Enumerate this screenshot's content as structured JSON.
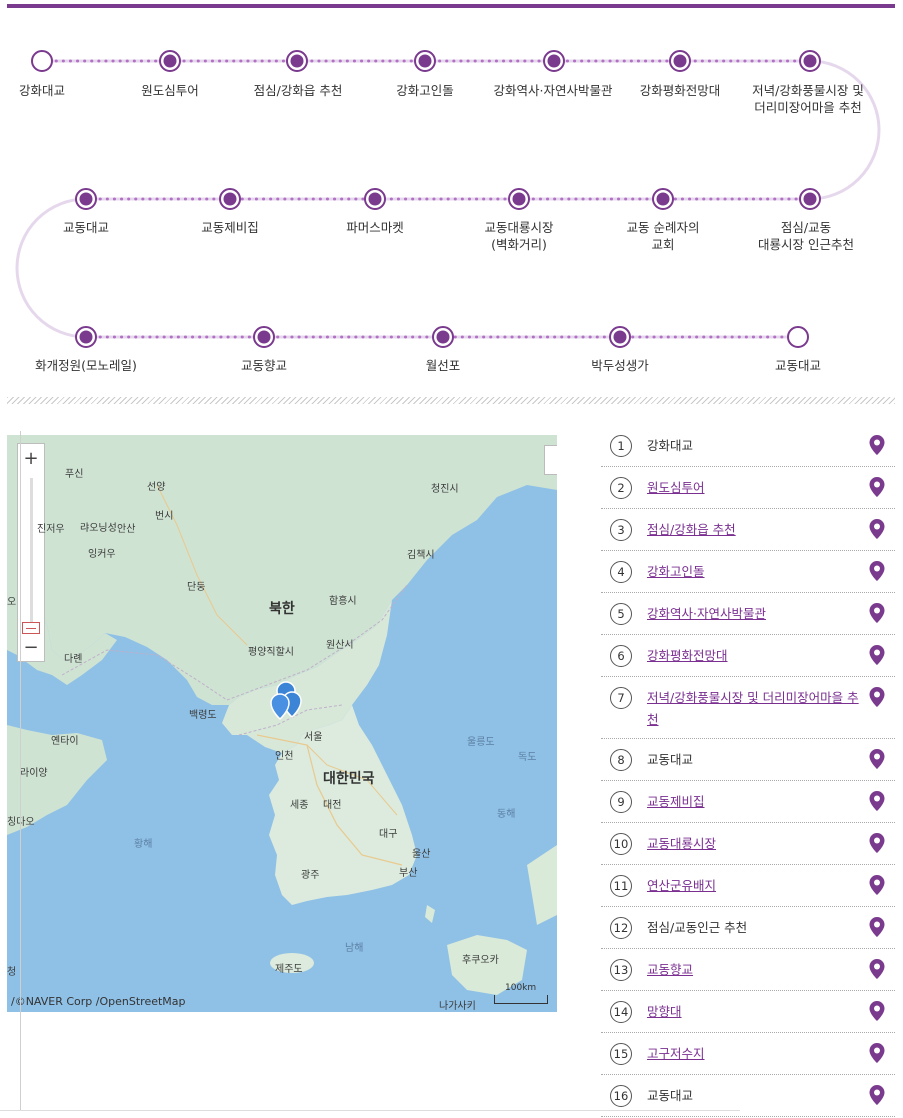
{
  "colors": {
    "accent": "#7a3a8e",
    "dot": "#7a3a8e",
    "link": "#7a2f91"
  },
  "course": {
    "stops": [
      {
        "label": "강화대교",
        "type": "start"
      },
      {
        "label": "원도심투어",
        "type": "stop"
      },
      {
        "label": "점심/강화읍 추천",
        "type": "stop"
      },
      {
        "label": "강화고인돌",
        "type": "stop"
      },
      {
        "label": "강화역사·자연사박물관",
        "type": "stop"
      },
      {
        "label": "강화평화전망대",
        "type": "stop"
      },
      {
        "label": "저녁/강화풍물시장 및\n더리미장어마을 추천",
        "type": "stop"
      },
      {
        "label": "교동대교",
        "type": "stop"
      },
      {
        "label": "교동제비집",
        "type": "stop"
      },
      {
        "label": "파머스마켓",
        "type": "stop"
      },
      {
        "label": "교동대룡시장\n(벽화거리)",
        "type": "stop"
      },
      {
        "label": "교동 순례자의\n교회",
        "type": "stop"
      },
      {
        "label": "점심/교동\n대룡시장 인근추천",
        "type": "stop"
      },
      {
        "label": "화개정원(모노레일)",
        "type": "stop"
      },
      {
        "label": "교동향교",
        "type": "stop"
      },
      {
        "label": "월선포",
        "type": "stop"
      },
      {
        "label": "박두성생가",
        "type": "stop"
      },
      {
        "label": "교동대교",
        "type": "end"
      }
    ]
  },
  "map": {
    "zoom_in_label": "+",
    "zoom_out_label": "−",
    "credit": "/©NAVER Corp /OpenStreetMap",
    "scale_label": "100km",
    "places": [
      {
        "name": "푸신",
        "kind": "city"
      },
      {
        "name": "선양",
        "kind": "city"
      },
      {
        "name": "번시",
        "kind": "city"
      },
      {
        "name": "진저우",
        "kind": "city"
      },
      {
        "name": "랴오닝성",
        "kind": "city"
      },
      {
        "name": "안산",
        "kind": "city"
      },
      {
        "name": "잉커우",
        "kind": "city"
      },
      {
        "name": "단둥",
        "kind": "city"
      },
      {
        "name": "다롄",
        "kind": "city"
      },
      {
        "name": "청진시",
        "kind": "city"
      },
      {
        "name": "김책시",
        "kind": "city"
      },
      {
        "name": "함흥시",
        "kind": "city"
      },
      {
        "name": "북한",
        "kind": "country"
      },
      {
        "name": "평양직할시",
        "kind": "capital"
      },
      {
        "name": "원산시",
        "kind": "city"
      },
      {
        "name": "백령도",
        "kind": "city"
      },
      {
        "name": "서울",
        "kind": "capital"
      },
      {
        "name": "인천",
        "kind": "city"
      },
      {
        "name": "옌타이",
        "kind": "city"
      },
      {
        "name": "라이양",
        "kind": "city"
      },
      {
        "name": "칭다오",
        "kind": "city"
      },
      {
        "name": "울릉도",
        "kind": "sea"
      },
      {
        "name": "독도",
        "kind": "sea"
      },
      {
        "name": "대한민국",
        "kind": "country"
      },
      {
        "name": "세종",
        "kind": "city"
      },
      {
        "name": "대전",
        "kind": "city"
      },
      {
        "name": "동해",
        "kind": "sea"
      },
      {
        "name": "황해",
        "kind": "sea"
      },
      {
        "name": "대구",
        "kind": "city"
      },
      {
        "name": "울산",
        "kind": "city"
      },
      {
        "name": "광주",
        "kind": "city"
      },
      {
        "name": "부산",
        "kind": "city"
      },
      {
        "name": "남해",
        "kind": "sea"
      },
      {
        "name": "후쿠오카",
        "kind": "city"
      },
      {
        "name": "제주도",
        "kind": "city"
      },
      {
        "name": "나가사키",
        "kind": "city"
      },
      {
        "name": "오",
        "kind": "city"
      },
      {
        "name": "청",
        "kind": "city"
      }
    ]
  },
  "poi_list": [
    {
      "num": "1",
      "name": "강화대교",
      "link": false
    },
    {
      "num": "2",
      "name": "원도심투어",
      "link": true
    },
    {
      "num": "3",
      "name": "점심/강화읍 추천",
      "link": true
    },
    {
      "num": "4",
      "name": "강화고인돌",
      "link": true
    },
    {
      "num": "5",
      "name": "강화역사·자연사박물관",
      "link": true
    },
    {
      "num": "6",
      "name": "강화평화전망대",
      "link": true
    },
    {
      "num": "7",
      "name": "저녁/강화풍물시장 및 더리미장어마을 추천",
      "link": true
    },
    {
      "num": "8",
      "name": "교동대교",
      "link": false
    },
    {
      "num": "9",
      "name": "교동제비집",
      "link": true
    },
    {
      "num": "10",
      "name": "교동대룡시장",
      "link": true
    },
    {
      "num": "11",
      "name": "연산군유배지",
      "link": true
    },
    {
      "num": "12",
      "name": "점심/교동인근 추천",
      "link": false
    },
    {
      "num": "13",
      "name": "교동향교",
      "link": true
    },
    {
      "num": "14",
      "name": "망향대",
      "link": true
    },
    {
      "num": "15",
      "name": "고구저수지",
      "link": true
    },
    {
      "num": "16",
      "name": "교동대교",
      "link": false
    }
  ]
}
